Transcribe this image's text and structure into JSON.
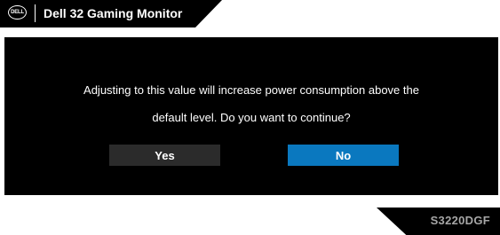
{
  "header": {
    "logo_text": "DELL",
    "title": "Dell 32 Gaming Monitor"
  },
  "dialog": {
    "message_line1": "Adjusting to this value will increase power consumption above the",
    "message_line2": "default level. Do you want to continue?",
    "yes_label": "Yes",
    "no_label": "No",
    "selected": "No"
  },
  "footer": {
    "model": "S3220DGF"
  },
  "colors": {
    "background": "#ffffff",
    "panel": "#000000",
    "yes_button": "#2b2b2b",
    "no_button_selected": "#0a78bf",
    "model_text": "#a6a6a6"
  },
  "icons": {
    "logo": "dell-logo-icon"
  }
}
